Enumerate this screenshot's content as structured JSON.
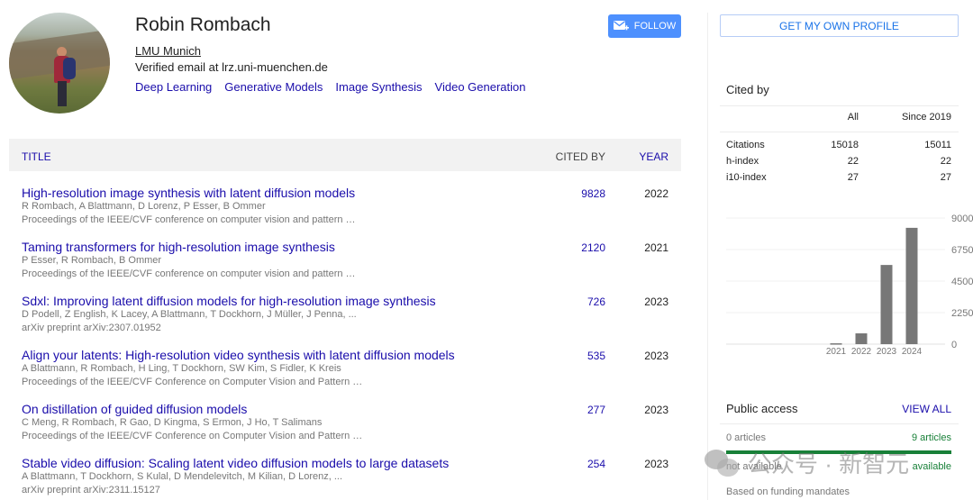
{
  "profile": {
    "name": "Robin Rombach",
    "affiliation": "LMU Munich",
    "email": "Verified email at lrz.uni-muenchen.de",
    "interests": [
      "Deep Learning",
      "Generative Models",
      "Image Synthesis",
      "Video Generation"
    ],
    "follow_label": "FOLLOW"
  },
  "table": {
    "headers": {
      "title": "TITLE",
      "cited_by": "CITED BY",
      "year": "YEAR"
    },
    "rows": [
      {
        "title": "High-resolution image synthesis with latent diffusion models",
        "authors": "R Rombach, A Blattmann, D Lorenz, P Esser, B Ommer",
        "venue": "Proceedings of the IEEE/CVF conference on computer vision and pattern …",
        "cited_by": "9828",
        "year": "2022"
      },
      {
        "title": "Taming transformers for high-resolution image synthesis",
        "authors": "P Esser, R Rombach, B Ommer",
        "venue": "Proceedings of the IEEE/CVF conference on computer vision and pattern …",
        "cited_by": "2120",
        "year": "2021"
      },
      {
        "title": "Sdxl: Improving latent diffusion models for high-resolution image synthesis",
        "authors": "D Podell, Z English, K Lacey, A Blattmann, T Dockhorn, J Müller, J Penna, ...",
        "venue": "arXiv preprint arXiv:2307.01952",
        "cited_by": "726",
        "year": "2023"
      },
      {
        "title": "Align your latents: High-resolution video synthesis with latent diffusion models",
        "authors": "A Blattmann, R Rombach, H Ling, T Dockhorn, SW Kim, S Fidler, K Kreis",
        "venue": "Proceedings of the IEEE/CVF Conference on Computer Vision and Pattern …",
        "cited_by": "535",
        "year": "2023"
      },
      {
        "title": "On distillation of guided diffusion models",
        "authors": "C Meng, R Rombach, R Gao, D Kingma, S Ermon, J Ho, T Salimans",
        "venue": "Proceedings of the IEEE/CVF Conference on Computer Vision and Pattern …",
        "cited_by": "277",
        "year": "2023"
      },
      {
        "title": "Stable video diffusion: Scaling latent video diffusion models to large datasets",
        "authors": "A Blattmann, T Dockhorn, S Kulal, D Mendelevitch, M Kilian, D Lorenz, ...",
        "venue": "arXiv preprint arXiv:2311.15127",
        "cited_by": "254",
        "year": "2023"
      }
    ]
  },
  "sidebar": {
    "own_profile_label": "GET MY OWN PROFILE",
    "cited_by": {
      "title": "Cited by",
      "col_all": "All",
      "col_since": "Since 2019",
      "rows": [
        {
          "label": "Citations",
          "all": "15018",
          "since": "15011"
        },
        {
          "label": "h-index",
          "all": "22",
          "since": "22"
        },
        {
          "label": "i10-index",
          "all": "27",
          "since": "27"
        }
      ]
    },
    "public_access": {
      "title": "Public access",
      "view_all": "VIEW ALL",
      "left_count": "0 articles",
      "right_count": "9 articles",
      "left_label": "not available",
      "right_label": "available",
      "available_fraction": 1.0,
      "note": "Based on funding mandates"
    }
  },
  "chart_data": {
    "type": "bar",
    "title": "",
    "xlabel": "",
    "ylabel": "",
    "categories": [
      "2021",
      "2022",
      "2023",
      "2024"
    ],
    "values": [
      60,
      770,
      5650,
      8300
    ],
    "ylim": [
      0,
      9000
    ],
    "yticks": [
      0,
      2250,
      4500,
      6750,
      9000
    ],
    "grid": true,
    "bar_color": "#777777",
    "axis_side": "right"
  },
  "watermark": {
    "text": "公众号 · 新智元"
  },
  "colors": {
    "link": "#1a0dab",
    "follow_bg": "#4d90fe",
    "available": "#188038"
  }
}
